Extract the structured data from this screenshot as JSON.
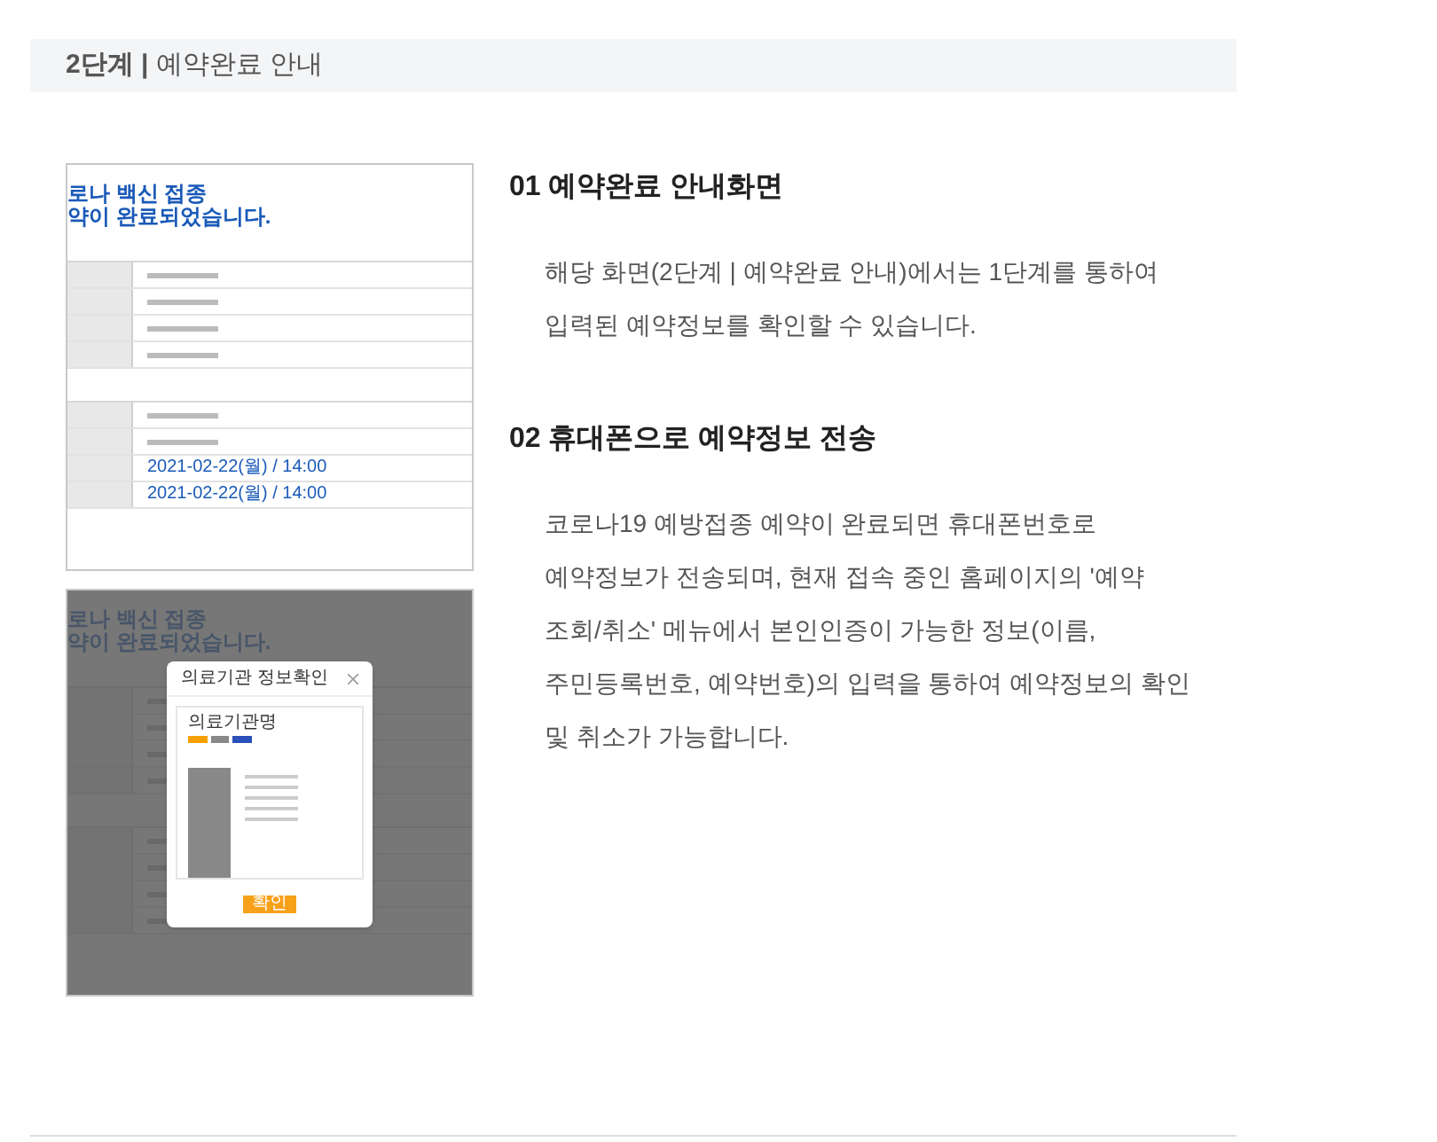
{
  "header": {
    "title": "**2단계 |** 예약완료 안내"
  },
  "thumbnails": [
    {
      "title_lines": [
        "로나 백신 접종",
        "약이 완료되었습니다."
      ],
      "dates": [
        "2021-02-22(월) / 14:00",
        "2021-02-22(월) / 14:00"
      ]
    },
    {
      "title_lines": [
        "로나 백신 접종",
        "약이 완료되었습니다."
      ],
      "modal": {
        "title": "의료기관 정보확인",
        "name": "의료기관명",
        "button": "확인"
      }
    }
  ],
  "sections": [
    {
      "heading": "01 예약완료 안내화면",
      "lines": [
        "해당 화면(2단계 | 예약완료 안내)에서는 1단계를 통하여",
        "입력된 예약정보를 확인할 수 있습니다."
      ]
    },
    {
      "heading": "02 휴대폰으로 예약정보 전송",
      "lines": [
        "코로나19 예방접종 예약이 완료되면 휴대폰번호로",
        "예약정보가 전송되며, 현재 접속 중인 홈페이지의 '예약",
        "조회/취소' 메뉴에서 본인인증이 가능한 정보(이름,",
        "주민등록번호, 예약번호)의 입력을 통하여 예약정보의 확인",
        "및 취소가 가능합니다."
      ]
    }
  ]
}
